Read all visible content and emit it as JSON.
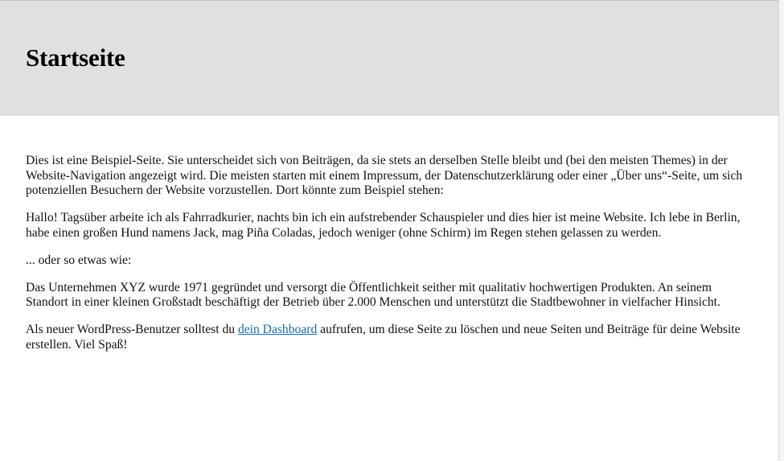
{
  "page": {
    "title": "Startseite"
  },
  "content": {
    "paragraph_1": "Dies ist eine Beispiel-Seite. Sie unterscheidet sich von Beiträgen, da sie stets an derselben Stelle bleibt und (bei den meisten Themes) in der Website-Navigation angezeigt wird. Die meisten starten mit einem Impressum, der Datenschutzerklärung oder einer „Über uns“-Seite, um sich potenziellen Besuchern der Website vorzustellen. Dort könnte zum Beispiel stehen:",
    "paragraph_2": "Hallo! Tagsüber arbeite ich als Fahrradkurier, nachts bin ich ein aufstrebender Schauspieler und dies hier ist meine Website. Ich lebe in Berlin, habe einen großen Hund namens Jack, mag Piña Coladas, jedoch weniger (ohne Schirm) im Regen stehen gelassen zu werden.",
    "paragraph_3": "... oder so etwas wie:",
    "paragraph_4": "Das Unternehmen XYZ wurde 1971 gegründet und versorgt die Öffentlichkeit seither mit qualitativ hochwertigen Produkten. An seinem Standort in einer kleinen Großstadt beschäftigt der Betrieb über 2.000 Menschen und unterstützt die Stadtbewohner in vielfacher Hinsicht.",
    "paragraph_5_before": "Als neuer WordPress-Benutzer solltest du ",
    "paragraph_5_link": "dein Dashboard",
    "paragraph_5_after": " aufrufen, um diese Seite zu löschen und neue Seiten und Beiträge für deine Website erstellen. Viel Spaß!"
  },
  "colors": {
    "header_background": "#e0e0e0",
    "link": "#1a6ba8"
  }
}
